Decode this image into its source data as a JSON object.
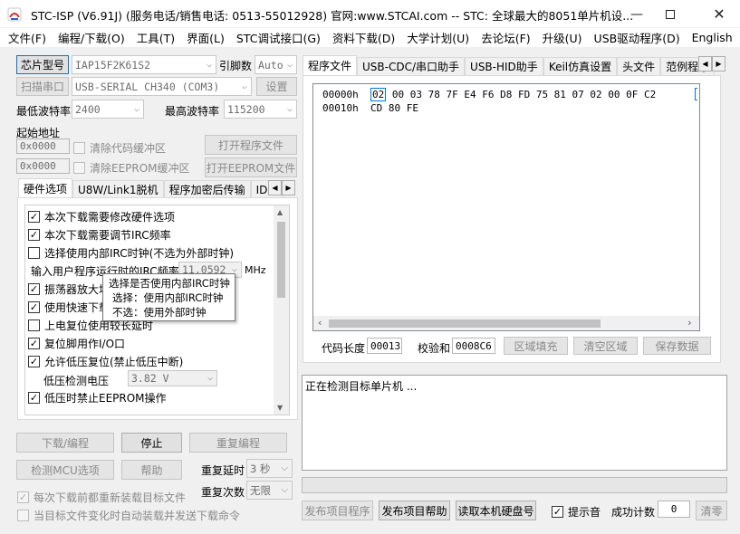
{
  "window": {
    "title": "STC-ISP (V6.91J) (服务电话/销售电话: 0513-55012928) 官网:www.STCAI.com  -- STC: 全球最大的8051单片机设..."
  },
  "menu": [
    "文件(F)",
    "编程/下载(O)",
    "工具(T)",
    "界面(L)",
    "STC调试接口(G)",
    "资料下载(D)",
    "大学计划(U)",
    "去论坛(F)",
    "升级(U)",
    "USB驱动程序(D)",
    "English"
  ],
  "left": {
    "chip_btn": "芯片型号",
    "chip_value": "IAP15F2K61S2",
    "pins_label": "引脚数",
    "pins_value": "Auto",
    "scan_btn": "扫描串口",
    "port_value": "USB-SERIAL CH340 (COM3)",
    "settings_btn": "设置",
    "min_baud_label": "最低波特率",
    "min_baud_value": "2400",
    "max_baud_label": "最高波特率",
    "max_baud_value": "115200",
    "start_addr_label": "起始地址",
    "addr1": "0x0000",
    "clear_code_label": "清除代码缓冲区",
    "open_prog_btn": "打开程序文件",
    "addr2": "0x0000",
    "clear_eeprom_label": "清除EEPROM缓冲区",
    "open_eeprom_btn": "打开EEPROM文件",
    "tabs": [
      "硬件选项",
      "U8W/Link1脱机",
      "程序加密后传输",
      "ID号"
    ],
    "options": {
      "o1": "本次下载需要修改硬件选项",
      "o2": "本次下载需要调节IRC频率",
      "o3": "选择使用内部IRC时钟(不选为外部时钟)",
      "irc_label": "输入用户程序运行时的IRC频率",
      "irc_value": "11.0592",
      "irc_unit": "MHz",
      "o4": "振荡器放大增益(12M以上建议选择)",
      "o5": "使用快速下载模式",
      "o6": "上电复位使用较长延时",
      "o7": "复位脚用作I/O口",
      "o8": "允许低压复位(禁止低压中断)",
      "lv_label": "低压检测电压",
      "lv_value": "3.82 V",
      "o9": "低压时禁止EEPROM操作"
    },
    "download_btn": "下载/编程",
    "stop_btn": "停止",
    "reprog_btn": "重复编程",
    "detect_btn": "检测MCU选项",
    "help_btn": "帮助",
    "repeat_delay_label": "重复延时",
    "repeat_delay_value": "3 秒",
    "repeat_count_label": "重复次数",
    "repeat_count_value": "无限",
    "reload_label": "每次下载前都重新装载目标文件",
    "auto_send_label": "当目标文件变化时自动装载并发送下载命令"
  },
  "tooltip": {
    "line1": "选择是否使用内部IRC时钟",
    "line2": "选择：使用内部IRC时钟",
    "line3": "不选：使用外部时钟"
  },
  "right": {
    "tabs": [
      "程序文件",
      "USB-CDC/串口助手",
      "USB-HID助手",
      "Keil仿真设置",
      "头文件",
      "范例程序"
    ],
    "hex": {
      "addr0": "00000h",
      "first_byte": "02",
      "row0_rest": "00 03 78 7F E4 F6 D8 FD 75 81 07 02 00 0F C2",
      "addr1": "00010h",
      "row1": "CD 80 FE"
    },
    "code_len_label": "代码长度",
    "code_len_value": "00013",
    "checksum_label": "校验和",
    "checksum_value": "0008C6",
    "fill_btn": "区域填充",
    "clear_btn": "清空区域",
    "save_btn": "保存数据",
    "log": "正在检测目标单片机 ...",
    "publish_btn": "发布项目程序",
    "publish_help_btn": "发布项目帮助",
    "read_disk_btn": "读取本机硬盘号",
    "sound_label": "提示音",
    "success_label": "成功计数",
    "success_value": "0",
    "clear_count_btn": "清零"
  }
}
